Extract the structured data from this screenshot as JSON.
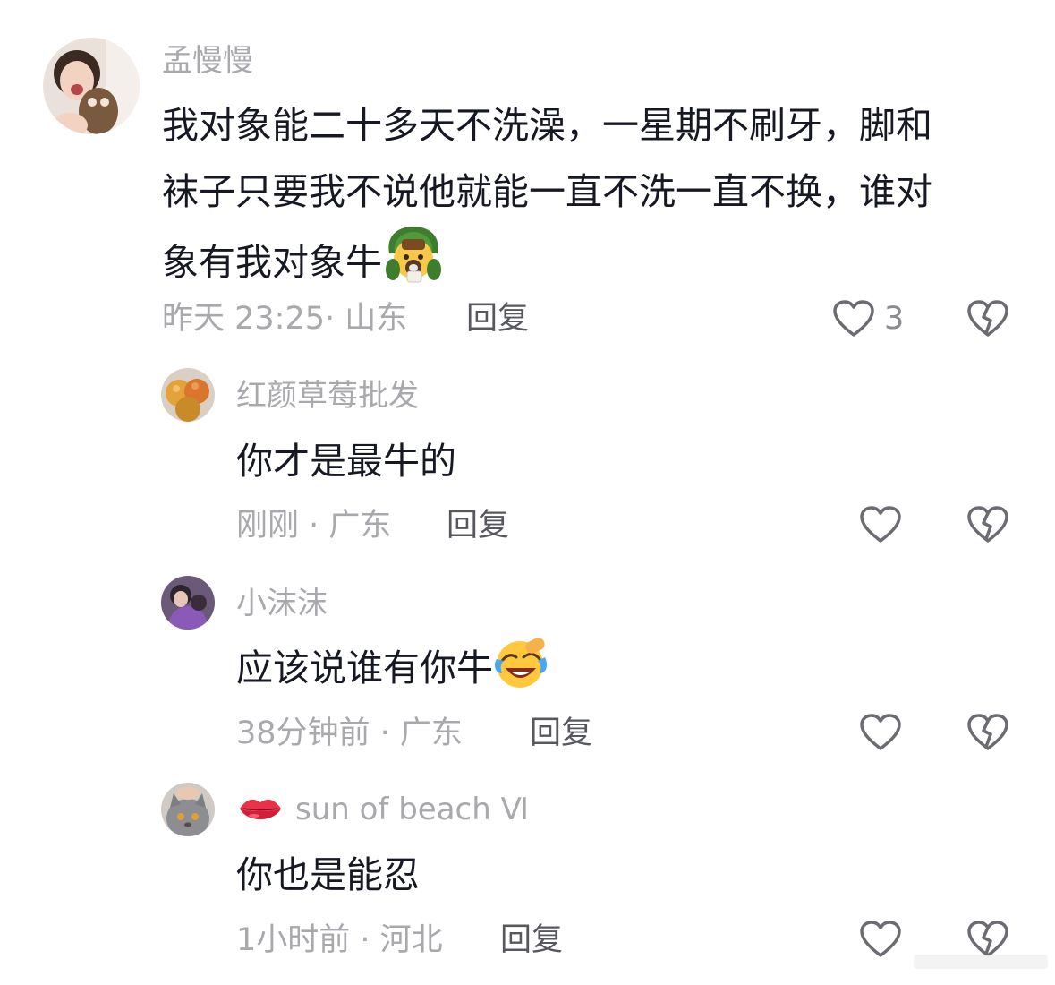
{
  "comments": [
    {
      "username": "孟慢慢",
      "text_line1": "我对象能二十多天不洗澡，一星期不刷牙，脚和",
      "text_line2": "袜子只要我不说他就能一直不洗一直不换，谁对",
      "text_line3": "象有我对象牛",
      "meta": "昨天 23:25· 山东",
      "reply_label": "回复",
      "like_count": "3"
    },
    {
      "username": "红颜草莓批发",
      "text": "你才是最牛的",
      "meta": "刚刚 · 广东",
      "reply_label": "回复"
    },
    {
      "username": "小沫沫",
      "text": "应该说谁有你牛",
      "meta": "38分钟前 · 广东",
      "reply_label": "回复"
    },
    {
      "username": "sun of beach Ⅵ",
      "text": "你也是能忍",
      "meta": "1小时前 · 河北",
      "reply_label": "回复"
    }
  ],
  "colors": {
    "text": "#161823",
    "secondary": "#a8a8ad",
    "reply": "#57585f",
    "icon": "#6b6c72"
  },
  "icons": {
    "like": "heart-outline-icon",
    "dislike": "broken-heart-icon"
  }
}
